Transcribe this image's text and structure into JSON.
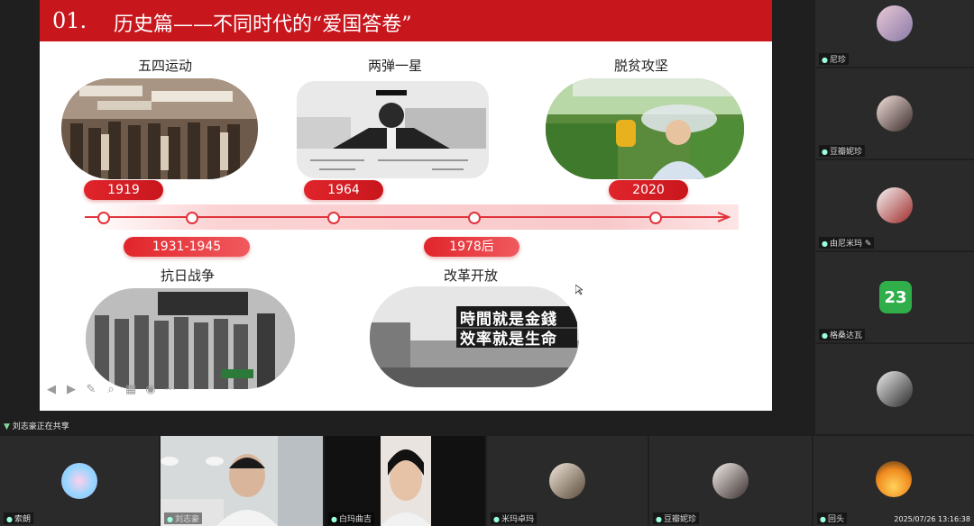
{
  "slide": {
    "section_number": "01.",
    "section_title": "历史篇——不同时代的“爱国答卷”",
    "events_top": [
      {
        "title": "五四运动",
        "year": "1919"
      },
      {
        "title": "两弹一星",
        "year": "1964"
      },
      {
        "title": "脱贫攻坚",
        "year": "2020"
      }
    ],
    "events_bottom": [
      {
        "title": "抗日战争",
        "year": "1931-1945"
      },
      {
        "title": "改革开放",
        "year": "1978后"
      }
    ],
    "photo_captions": {
      "reform_line1": "時間就是金錢",
      "reform_line2": "效率就是生命"
    }
  },
  "sharing_status": "刘志豪正在共享",
  "participants_right": [
    {
      "name": "尼珍"
    },
    {
      "name": "豆瓣妮珍"
    },
    {
      "name": "由尼米玛"
    },
    {
      "name": "格桑达瓦"
    },
    {
      "name": ""
    }
  ],
  "participants_bottom": [
    {
      "name": "索朗"
    },
    {
      "name": "刘志豪"
    },
    {
      "name": "白玛曲吉"
    },
    {
      "name": "米玛卓玛"
    },
    {
      "name": "豆瓣妮珍"
    },
    {
      "name": "回头"
    }
  ],
  "right_tile_badge": "23",
  "timestamp": "2025/07/26 13:16:38",
  "colors": {
    "accent_red": "#c8161d",
    "tile_bg": "#2a2a2a"
  }
}
